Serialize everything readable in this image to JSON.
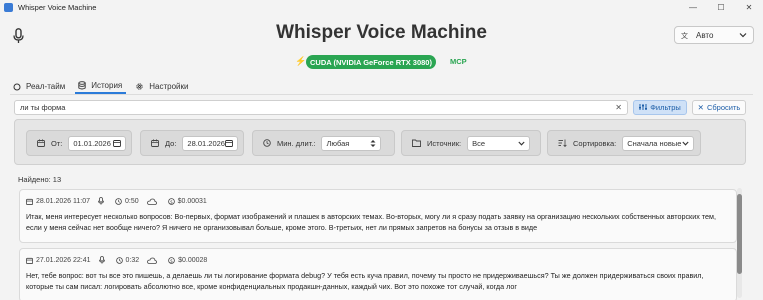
{
  "window": {
    "title": "Whisper Voice Machine",
    "controls": [
      "—",
      "☐",
      "✕"
    ]
  },
  "header": {
    "title": "Whisper Voice Machine",
    "mic_icon": "microphone-icon",
    "language_select": {
      "value": "Авто",
      "icon": "translate-icon"
    }
  },
  "device": {
    "badge": "CUDA (NVIDIA GeForce RTX 3080)",
    "mcp": "MCP",
    "icon": "bolt-icon"
  },
  "tabs": [
    {
      "label": "Реал-тайм",
      "icon": "circle-icon",
      "active": false
    },
    {
      "label": "История",
      "icon": "database-icon",
      "active": true
    },
    {
      "label": "Настройки",
      "icon": "gear-icon",
      "active": false
    }
  ],
  "search": {
    "value": "ли ты форма",
    "filters_label": "Фильтры",
    "reset_label": "Сбросить"
  },
  "filters": {
    "from": {
      "label": "От:",
      "value": "01.01.2026"
    },
    "to": {
      "label": "До:",
      "value": "28.01.2026"
    },
    "min_duration": {
      "label": "Мин. длит.:",
      "value": "Любая"
    },
    "source": {
      "label": "Источник:",
      "value": "Все"
    },
    "sort": {
      "label": "Сортировка:",
      "value": "Сначала новые"
    }
  },
  "found": "Найдено: 13",
  "results": [
    {
      "date": "28.01.2026 11:07",
      "duration": "0:50",
      "cost": "$0.00031",
      "text": "Итак, меня интересует несколько вопросов: Во-первых, формат изображений и плашек в авторских темах. Во-вторых, могу ли я сразу подать заявку на организацию нескольких собственных авторских тем, если у меня сейчас нет вообще ничего? Я ничего не организовывал больше, кроме этого. В-третьих, нет ли прямых запретов на бонусы за отзыв в виде"
    },
    {
      "date": "27.01.2026 22:41",
      "duration": "0:32",
      "cost": "$0.00028",
      "text": "Нет, тебе вопрос: вот ты все это пишешь, а делаешь ли ты логирование формата debug? У тебя есть куча правил, почему ты просто не придерживаешься? Ты же должен придерживаться своих правил, которые ты сам писал: логировать абсолютно все, кроме конфиденциальных продакшн-данных, каждый чих. Вот это похоже тот случай, когда лог"
    }
  ]
}
